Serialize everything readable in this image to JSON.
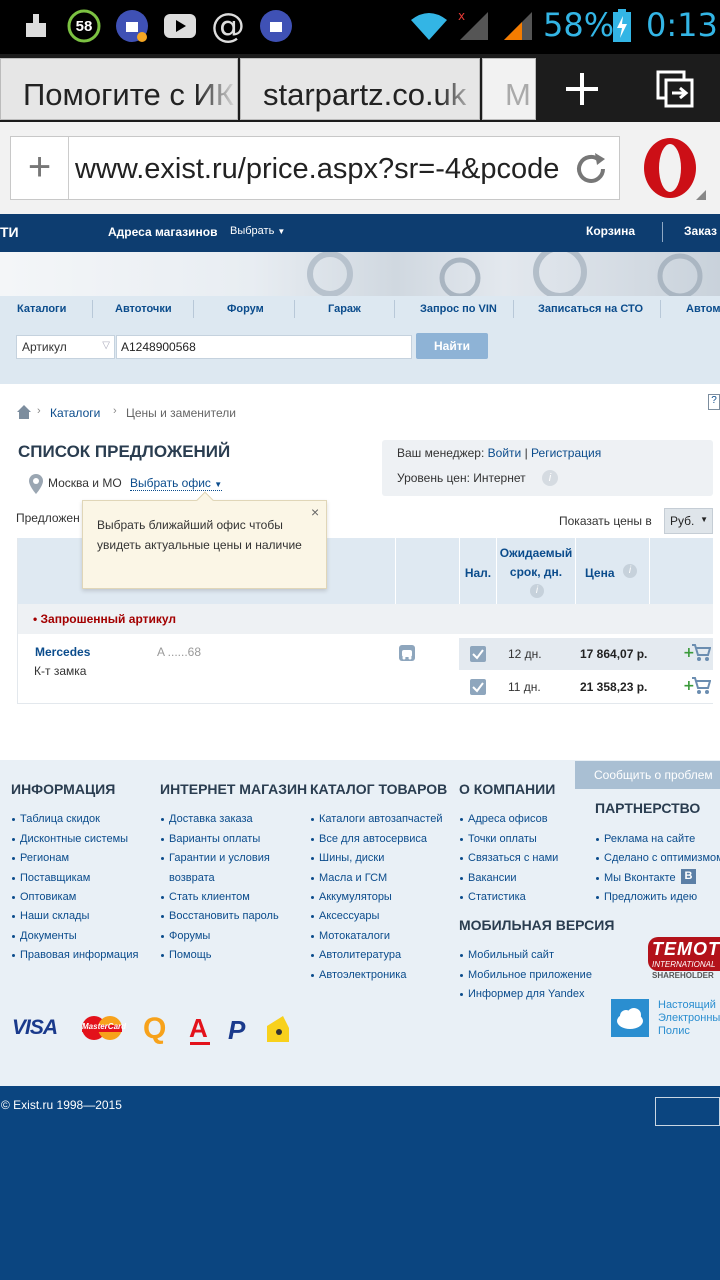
{
  "status_bar": {
    "notification_count": "58",
    "battery_percent": "58%",
    "time": "0:13"
  },
  "browser": {
    "tabs": [
      {
        "label": "Помогите с ИК"
      },
      {
        "label": "starpartz.co.uk"
      },
      {
        "label": "M"
      }
    ],
    "url": "www.exist.ru/price.aspx?sr=-4&pcode"
  },
  "site": {
    "header_left": "ТИ",
    "stores_link": "Адреса магазинов",
    "choose_link": "Выбрать",
    "cart_link": "Корзина",
    "orders_link": "Заказ",
    "nav": [
      "Каталоги",
      "Автоточки",
      "Форум",
      "Гараж",
      "Запрос по VIN",
      "Записаться на СТО",
      "Автоме"
    ],
    "search": {
      "select_value": "Артикул",
      "query_value": "A1248900568",
      "find_button": "Найти"
    },
    "breadcrumb": {
      "catalogs": "Каталоги",
      "current": "Цены и заменители"
    },
    "offers": {
      "title": "СПИСОК ПРЕДЛОЖЕНИЙ",
      "region": "Москва и МО",
      "choose_office": "Выбрать офис",
      "offers_label": "Предложен",
      "tooltip": "Выбрать ближайший офис чтобы увидеть актуальные цены и наличие",
      "manager_label": "Ваш менеджер:",
      "login_link": "Войти",
      "register_link": "Регистрация",
      "price_level": "Уровень цен: Интернет",
      "show_prices_label": "Показать цены в",
      "currency": "Руб.",
      "columns": {
        "availability": "Нал.",
        "expected_line1": "Ожидаемый",
        "expected_line2": "срок, дн.",
        "price": "Цена"
      },
      "requested_article": "• Запрошенный артикул",
      "item": {
        "brand": "Mercedes",
        "code": "A ......68",
        "description": "К-т замка"
      },
      "rows": [
        {
          "days": "12 дн.",
          "price": "17 864,07 р."
        },
        {
          "days": "11 дн.",
          "price": "21 358,23 р."
        }
      ]
    }
  },
  "footer": {
    "report_button": "Сообщить о проблем",
    "columns": [
      {
        "title": "ИНФОРМАЦИЯ",
        "links": [
          "Таблица скидок",
          "Дисконтные системы",
          "Регионам",
          "Поставщикам",
          "Оптовикам",
          "Наши склады",
          "Документы",
          "Правовая информация"
        ]
      },
      {
        "title": "ИНТЕРНЕТ МАГАЗИН",
        "links": [
          "Доставка заказа",
          "Варианты оплаты",
          "Гарантии и условия",
          "возврата",
          "Стать клиентом",
          "Восстановить пароль",
          "Форумы",
          "Помощь"
        ]
      },
      {
        "title": "КАТАЛОГ ТОВАРОВ",
        "links": [
          "Каталоги автозапчастей",
          "Все для автосервиса",
          "Шины, диски",
          "Масла и ГСМ",
          "Аккумуляторы",
          "Аксессуары",
          "Мотокаталоги",
          "Автолитература",
          "Автоэлектроника"
        ]
      },
      {
        "title": "О КОМПАНИИ",
        "links": [
          "Адреса офисов",
          "Точки оплаты",
          "Связаться с нами",
          "Вакансии",
          "Статистика"
        ]
      }
    ],
    "mobile_title": "МОБИЛЬНАЯ ВЕРСИЯ",
    "mobile_links": [
      "Мобильный сайт",
      "Мобильное приложение",
      "Информер для Yandex"
    ],
    "partnership_title": "ПАРТНЕРСТВО",
    "partnership_links": [
      "Реклама на сайте",
      "Сделано с оптимизмом",
      "Мы Вконтакте",
      "Предложить идею"
    ],
    "vk_badge": "B",
    "temot_line1": "TEMOT",
    "temot_line2": "INTERNATIONAL",
    "temot_line3": "SHAREHOLDER",
    "polis_line1": "Настоящий",
    "polis_line2": "Электронный",
    "polis_line3": "Полис",
    "payments": {
      "visa": "VISA",
      "mastercard": "MasterCard",
      "qiwi": "Q",
      "alfa": "А",
      "paypal": "P"
    },
    "copyright": "© Exist.ru 1998—2015"
  },
  "colors": {
    "site_dark_blue": "#0d3d70",
    "link_blue": "#0b4c8c",
    "accent_red": "#a30000",
    "opera_red": "#cc0f16",
    "status_blue": "#33b5e5"
  }
}
